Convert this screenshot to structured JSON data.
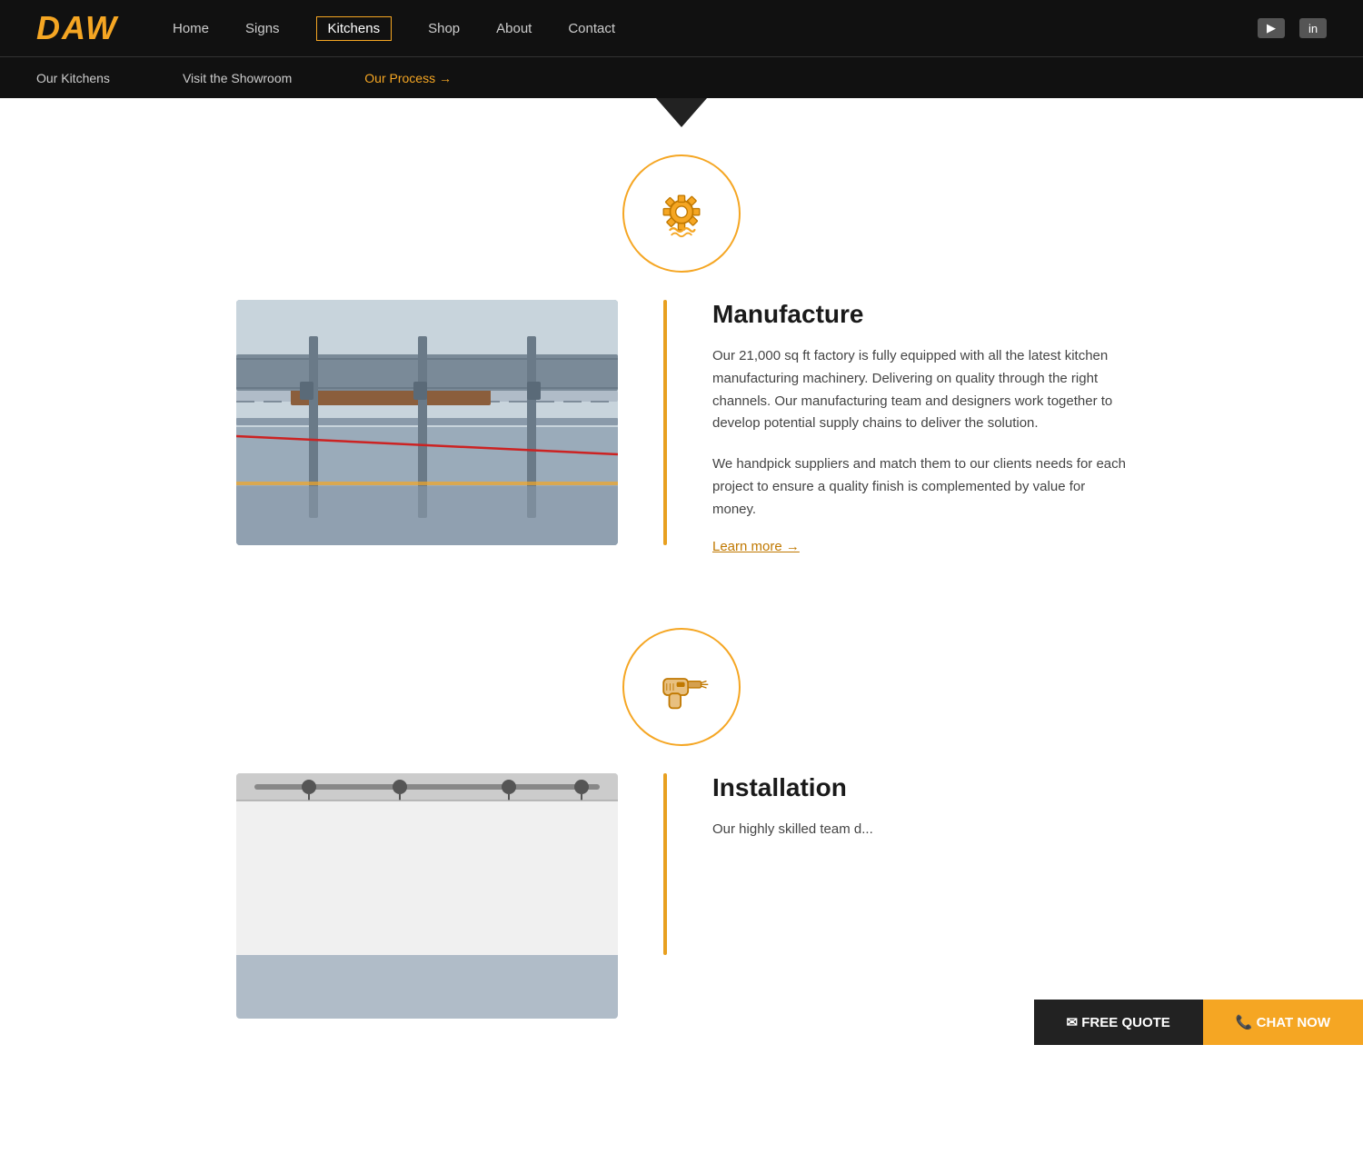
{
  "header": {
    "logo": "DAW",
    "nav": [
      {
        "label": "Home",
        "active": false
      },
      {
        "label": "Signs",
        "active": false
      },
      {
        "label": "Kitchens",
        "active": true
      },
      {
        "label": "Shop",
        "active": false
      },
      {
        "label": "About",
        "active": false
      },
      {
        "label": "Contact",
        "active": false
      }
    ],
    "icons": [
      {
        "name": "youtube-icon",
        "symbol": "▶"
      },
      {
        "name": "linkedin-icon",
        "symbol": "in"
      }
    ]
  },
  "subnav": [
    {
      "label": "Our Kitchens",
      "active": false
    },
    {
      "label": "Visit the Showroom",
      "active": false
    },
    {
      "label": "Our Process →",
      "active": true
    }
  ],
  "manufacture_section": {
    "title": "Manufacture",
    "body1": "Our 21,000 sq ft factory is fully equipped with all the latest kitchen manufacturing machinery. Delivering on quality through the right channels. Our manufacturing team and designers work together to develop potential supply chains to deliver the solution.",
    "body2": "We handpick suppliers and match them to our clients needs for each project to ensure a quality finish is complemented by value for money.",
    "learn_more": "Learn more →"
  },
  "installation_section": {
    "title": "Installation",
    "body1": "Our highly skilled team d..."
  },
  "cta": {
    "quote_label": "✉ FREE QUOTE",
    "chat_label": "📞 CHAT NOW"
  }
}
